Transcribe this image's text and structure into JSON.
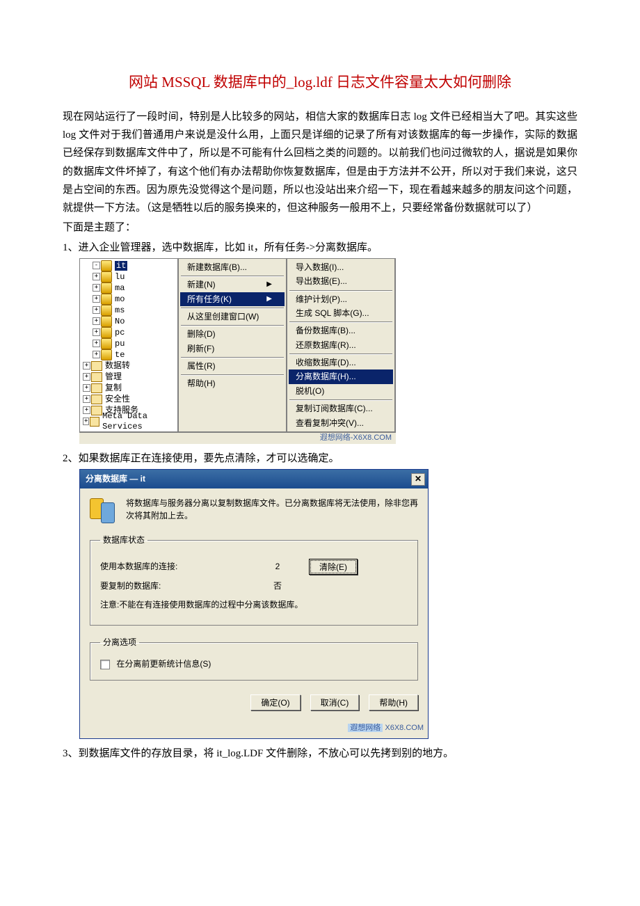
{
  "title": "网站 MSSQL 数据库中的_log.ldf 日志文件容量太大如何删除",
  "paragraphs": {
    "p1": "现在网站运行了一段时间，特别是人比较多的网站，相信大家的数据库日志 log 文件已经相当大了吧。其实这些 log 文件对于我们普通用户来说是没什么用，上面只是详细的记录了所有对该数据库的每一步操作，实际的数据已经保存到数据库文件中了，所以是不可能有什么回档之类的问题的。以前我们也问过微软的人，据说是如果你的数据库文件坏掉了，有这个他们有办法帮助你恢复数据库，但是由于方法并不公开，所以对于我们来说，这只是占空间的东西。因为原先没觉得这个是问题，所以也没站出来介绍一下，现在看越来越多的朋友问这个问题，就提供一下方法。（这是牺牲以后的服务换来的，但这种服务一般用不上，只要经常备份数据就可以了）",
    "p2": "下面是主题了：",
    "s1": "1、进入企业管理器，选中数据库，比如 it，所有任务->分离数据库。",
    "s2": "2、如果数据库正在连接使用，要先点清除，才可以选确定。",
    "s3": "3、到数据库文件的存放目录，将 it_log.LDF 文件删除，不放心可以先拷到别的地方。"
  },
  "scr1": {
    "tree": {
      "it": "it",
      "lu": "lu",
      "ma": "ma",
      "mo": "mo",
      "ms": "ms",
      "no": "No",
      "pc": "pc",
      "pu": "pu",
      "te": "te",
      "f1": "数据转",
      "f2": "管理",
      "f3": "复制",
      "f4": "安全性",
      "f5": "支持服务",
      "f6": "Meta Data Services"
    },
    "menu": {
      "new_db": "新建数据库(B)...",
      "new": "新建(N)",
      "all_tasks": "所有任务(K)",
      "window_from_here": "从这里创建窗口(W)",
      "delete": "删除(D)",
      "refresh": "刷新(F)",
      "properties": "属性(R)",
      "help": "帮助(H)"
    },
    "submenu": {
      "import": "导入数据(I)...",
      "export": "导出数据(E)...",
      "maintenance": "维护计划(P)...",
      "gen_sql": "生成 SQL 脚本(G)...",
      "backup": "备份数据库(B)...",
      "restore": "还原数据库(R)...",
      "shrink": "收缩数据库(D)...",
      "detach": "分离数据库(H)...",
      "offline": "脱机(O)",
      "copy_sub": "复制订阅数据库(C)...",
      "view_conflict": "查看复制冲突(V)..."
    },
    "watermark": "遐想网络-X6X8.COM"
  },
  "scr2": {
    "title": "分离数据库  —  it",
    "desc": "将数据库与服务器分离以复制数据库文件。已分离数据库将无法使用，除非您再次将其附加上去。",
    "grp_status": "数据库状态",
    "row_conn_k": "使用本数据库的连接:",
    "row_conn_v": "2",
    "btn_clear": "清除(E)",
    "row_repl_k": "要复制的数据库:",
    "row_repl_v": "否",
    "note": "注意:不能在有连接使用数据库的过程中分离该数据库。",
    "grp_options": "分离选项",
    "chk_update": "在分离前更新统计信息(S)",
    "btn_ok": "确定(O)",
    "btn_cancel": "取消(C)",
    "btn_help": "帮助(H)",
    "watermark_a": "遐想网络",
    "watermark_b": "X6X8.COM"
  }
}
